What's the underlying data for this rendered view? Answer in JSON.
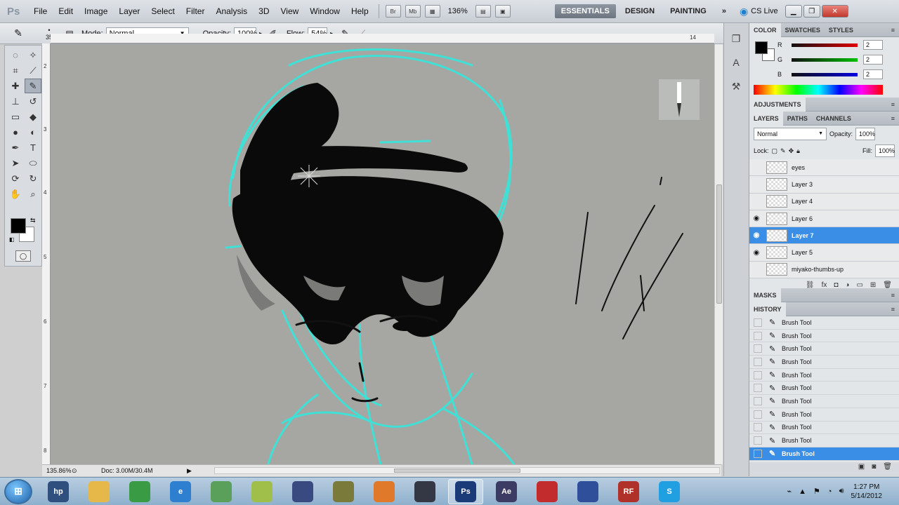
{
  "menubar": {
    "app_logo": "Ps",
    "items": [
      "File",
      "Edit",
      "Image",
      "Layer",
      "Select",
      "Filter",
      "Analysis",
      "3D",
      "View",
      "Window",
      "Help"
    ],
    "bridge": "Br",
    "minibridge": "Mb",
    "zoom": "136%",
    "workspaces": [
      "ESSENTIALS",
      "DESIGN",
      "PAINTING"
    ],
    "more": "»",
    "cslive": "CS Live"
  },
  "options": {
    "brush_size": "35",
    "mode_label": "Mode:",
    "mode_value": "Normal",
    "opacity_label": "Opacity:",
    "opacity_value": "100%",
    "flow_label": "Flow:",
    "flow_value": "54%"
  },
  "document": {
    "ruler_h": [
      "14"
    ],
    "ruler_v": [
      "2",
      "3",
      "4",
      "5",
      "6",
      "7",
      "8"
    ],
    "zoom_status": "135.86%",
    "doc_size": "Doc: 3.00M/30.4M"
  },
  "color_panel": {
    "tabs": [
      "COLOR",
      "SWATCHES",
      "STYLES"
    ],
    "sliders": [
      {
        "label": "R",
        "value": "2",
        "color": "#e00000"
      },
      {
        "label": "G",
        "value": "2",
        "color": "#00c000"
      },
      {
        "label": "B",
        "value": "2",
        "color": "#0000e0"
      }
    ]
  },
  "adjustments": {
    "title": "ADJUSTMENTS"
  },
  "layers_panel": {
    "tabs": [
      "LAYERS",
      "PATHS",
      "CHANNELS"
    ],
    "blend_mode": "Normal",
    "opacity_label": "Opacity:",
    "opacity_value": "100%",
    "lock_label": "Lock:",
    "fill_label": "Fill:",
    "fill_value": "100%",
    "layers": [
      {
        "name": "eyes",
        "visible": false,
        "selected": false
      },
      {
        "name": "Layer 3",
        "visible": false,
        "selected": false
      },
      {
        "name": "Layer 4",
        "visible": false,
        "selected": false
      },
      {
        "name": "Layer 6",
        "visible": true,
        "selected": false
      },
      {
        "name": "Layer 7",
        "visible": true,
        "selected": true
      },
      {
        "name": "Layer 5",
        "visible": true,
        "selected": false
      },
      {
        "name": "miyako-thumbs-up",
        "visible": false,
        "selected": false
      }
    ]
  },
  "masks": {
    "title": "MASKS"
  },
  "history_panel": {
    "title": "HISTORY",
    "entries": [
      "Brush Tool",
      "Brush Tool",
      "Brush Tool",
      "Brush Tool",
      "Brush Tool",
      "Brush Tool",
      "Brush Tool",
      "Brush Tool",
      "Brush Tool",
      "Brush Tool",
      "Brush Tool"
    ],
    "selected_index": 10
  },
  "taskbar": {
    "apps": [
      {
        "name": "hp",
        "label": "hp",
        "color": "#2f4f7f"
      },
      {
        "name": "explorer",
        "label": "",
        "color": "#e6b84a"
      },
      {
        "name": "chrome",
        "label": "",
        "color": "#3a9b45"
      },
      {
        "name": "ie",
        "label": "e",
        "color": "#2f7fd0"
      },
      {
        "name": "paint",
        "label": "",
        "color": "#5aa05a"
      },
      {
        "name": "notes",
        "label": "",
        "color": "#9fbf4a"
      },
      {
        "name": "movie",
        "label": "",
        "color": "#394a80"
      },
      {
        "name": "calc",
        "label": "",
        "color": "#7a7a3a"
      },
      {
        "name": "media",
        "label": "",
        "color": "#e07a2a"
      },
      {
        "name": "terminal",
        "label": "",
        "color": "#333844"
      },
      {
        "name": "photoshop",
        "label": "Ps",
        "color": "#1b3a78"
      },
      {
        "name": "aftereffects",
        "label": "Ae",
        "color": "#3c3b64"
      },
      {
        "name": "app-red",
        "label": "",
        "color": "#c22c2c"
      },
      {
        "name": "cinema4d",
        "label": "",
        "color": "#2f4f9a"
      },
      {
        "name": "rf",
        "label": "RF",
        "color": "#b0302a"
      },
      {
        "name": "skype",
        "label": "S",
        "color": "#20a0e0"
      }
    ],
    "clock_time": "1:27 PM",
    "clock_date": "5/14/2012"
  }
}
